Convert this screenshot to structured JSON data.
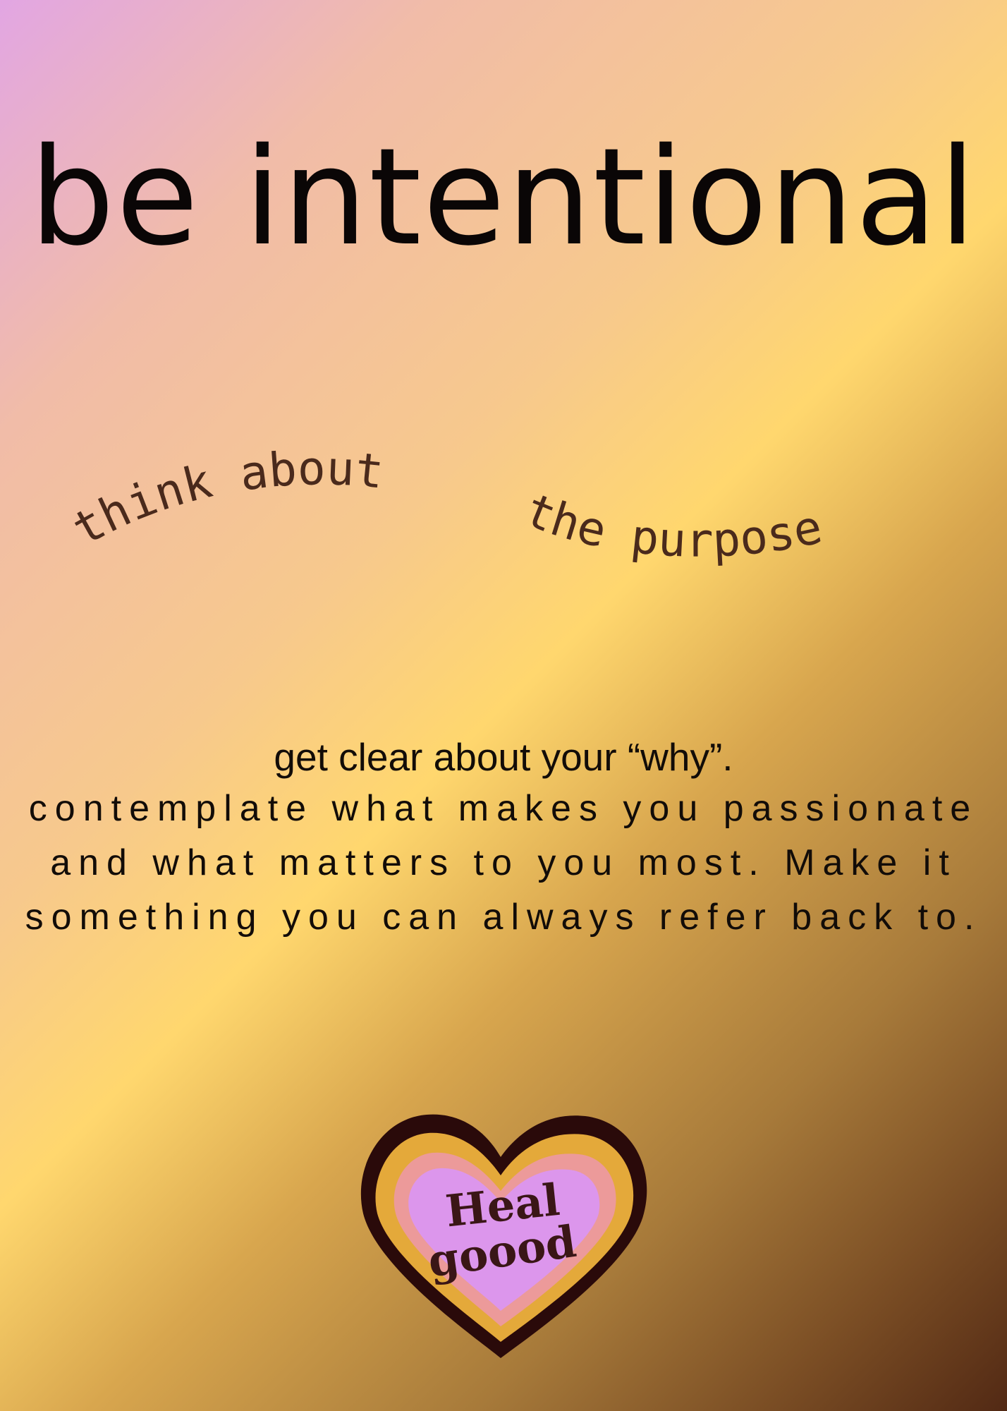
{
  "title": "be intentional",
  "subtitle": {
    "part1": "think about",
    "part2": "the purpose"
  },
  "body": {
    "line1": "get clear about your “why”.",
    "paragraph": "contemplate what makes you passionate and what matters to you most. Make it something you can always refer back to."
  },
  "logo": {
    "line1": "Heal",
    "line2": "goood"
  },
  "colors": {
    "text_dark": "#0a0606",
    "wave_text": "#4a2a1c",
    "heart_outline": "#2a0a0a",
    "heart_gold": "#e4a93a",
    "heart_pink": "#ec9a9a",
    "heart_lilac": "#dc96ec"
  }
}
